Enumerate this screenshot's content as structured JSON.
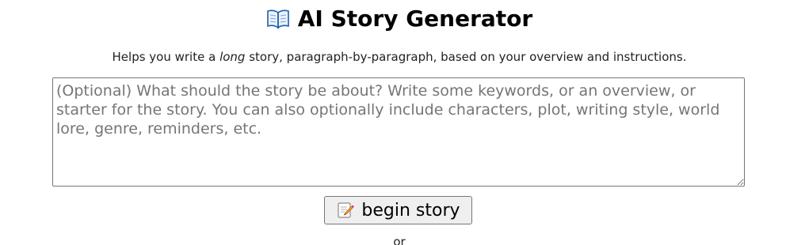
{
  "header": {
    "title": "AI Story Generator",
    "title_icon": "open-book-icon",
    "subtitle_before": "Helps you write a ",
    "subtitle_emphasis": "long",
    "subtitle_after": " story, paragraph-by-paragraph, based on your overview and instructions."
  },
  "overview": {
    "placeholder": "(Optional) What should the story be about? Write some keywords, or an overview, or starter for the story. You can also optionally include characters, plot, writing style, world lore, genre, reminders, etc.",
    "value": ""
  },
  "actions": {
    "begin_label": "begin story",
    "begin_icon": "memo-pencil-icon",
    "or_label": "or"
  },
  "colors": {
    "button_bg": "#efefef",
    "border": "#767676",
    "placeholder": "#757575"
  }
}
